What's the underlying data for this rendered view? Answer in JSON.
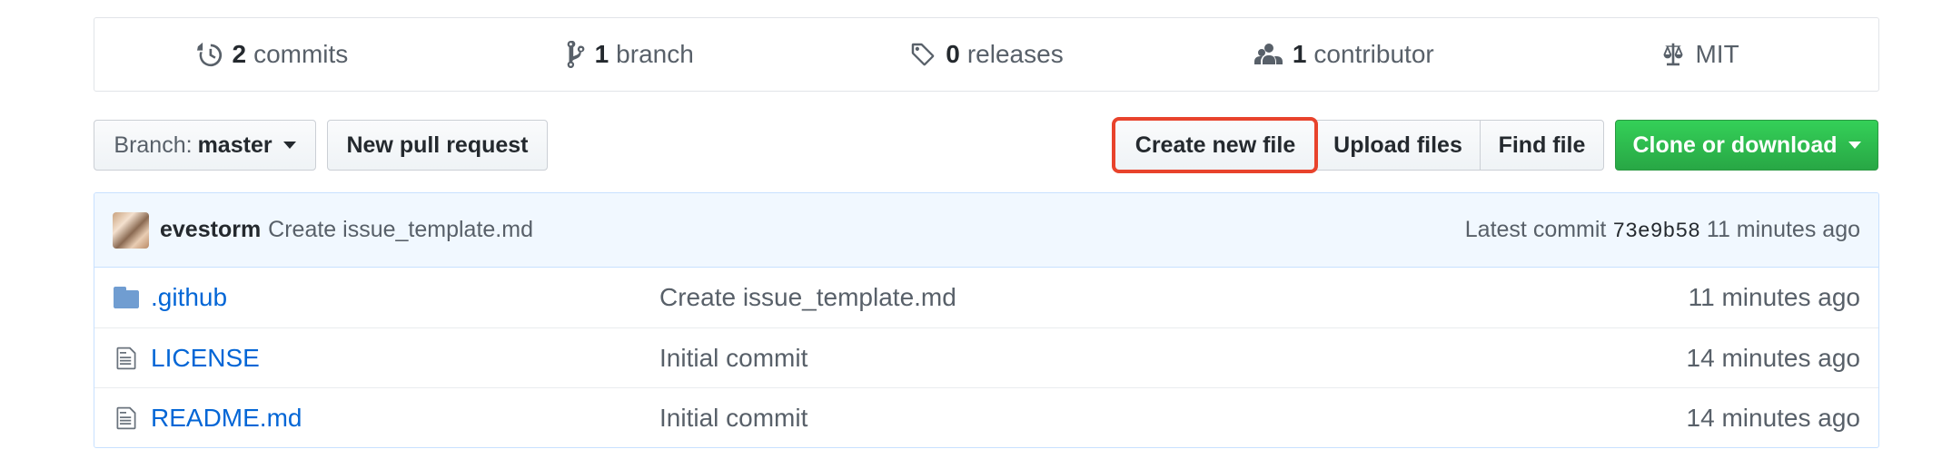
{
  "summary": {
    "commits": {
      "count": "2",
      "label": "commits",
      "icon": "history-icon"
    },
    "branches": {
      "count": "1",
      "label": "branch",
      "icon": "git-branch-icon"
    },
    "releases": {
      "count": "0",
      "label": "releases",
      "icon": "tag-icon"
    },
    "contributors": {
      "count": "1",
      "label": "contributor",
      "icon": "people-icon"
    },
    "license": {
      "label": "MIT",
      "icon": "law-icon"
    }
  },
  "toolbar": {
    "branch_prefix": "Branch:",
    "branch_name": "master",
    "new_pull_request": "New pull request",
    "create_new_file": "Create new file",
    "upload_files": "Upload files",
    "find_file": "Find file",
    "clone_or_download": "Clone or download"
  },
  "latest_commit": {
    "author": "evestorm",
    "message": "Create issue_template.md",
    "prefix": "Latest commit",
    "sha": "73e9b58",
    "age": "11 minutes ago"
  },
  "files": [
    {
      "name": ".github",
      "icon": "folder-icon",
      "message": "Create issue_template.md",
      "age": "11 minutes ago"
    },
    {
      "name": "LICENSE",
      "icon": "file-icon",
      "message": "Initial commit",
      "age": "14 minutes ago"
    },
    {
      "name": "README.md",
      "icon": "file-icon",
      "message": "Initial commit",
      "age": "14 minutes ago"
    }
  ],
  "colors": {
    "link": "#0366d6",
    "highlight": "#e8432c",
    "clone_green": "#28a745"
  }
}
